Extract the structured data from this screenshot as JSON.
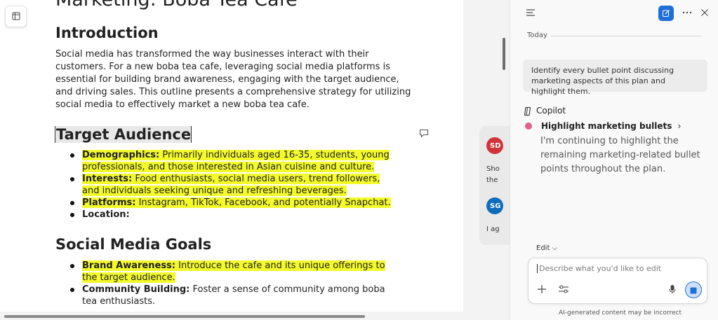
{
  "document": {
    "title": "Marketing: Boba Tea Cafe",
    "intro_heading": "Introduction",
    "intro_paragraph": "Social media has transformed the way businesses interact with their customers. For a new boba tea cafe, leveraging social media platforms is essential for building brand awareness, engaging with the target audience, and driving sales. This outline presents a comprehensive strategy for utilizing social media to effectively market a new boba tea cafe.",
    "target_heading": "Target Audience",
    "target_bullets": [
      {
        "term": "Demographics:",
        "text": " Primarily individuals aged 16-35, students, young professionals, and those interested in Asian cuisine and culture."
      },
      {
        "term": "Interests:",
        "text": " Food enthusiasts, social media users, trend followers, and individuals seeking unique and refreshing beverages."
      },
      {
        "term": "Platforms:",
        "text": " Instagram, TikTok, Facebook, and potentially Snapchat."
      },
      {
        "term": "Location:",
        "text": ""
      }
    ],
    "goals_heading": "Social Media Goals",
    "goals_bullets": [
      {
        "term": "Brand Awareness:",
        "text": " Introduce the cafe and its unique offerings to the target audience."
      },
      {
        "term": "Community Building:",
        "text": " Foster a sense of community among boba tea enthusiasts."
      }
    ]
  },
  "comments": {
    "items": [
      {
        "initials": "SD",
        "color": "#d13438",
        "snippet_1": "Sho",
        "snippet_2": "the"
      },
      {
        "initials": "SG",
        "color": "#0f6cbd",
        "snippet_1": "I ag",
        "snippet_2": ""
      }
    ]
  },
  "copilot": {
    "today_label": "Today",
    "user_message": "Identify every bullet point discussing marketing aspects of this plan and highlight them.",
    "assistant_name": "Copilot",
    "action_label": "Highlight marketing bullets",
    "action_chevron": "›",
    "reply_text": "I'm continuing to highlight the remaining marketing-related bullet points throughout the plan.",
    "edit_mode": "Edit ⌵",
    "input_placeholder": "Describe what you'd like to edit",
    "disclaimer": "AI-generated content may be incorrect"
  },
  "colors": {
    "highlight": "#f4fb2a",
    "accent": "#1f6fd8",
    "status_dot": "#e0608a"
  }
}
